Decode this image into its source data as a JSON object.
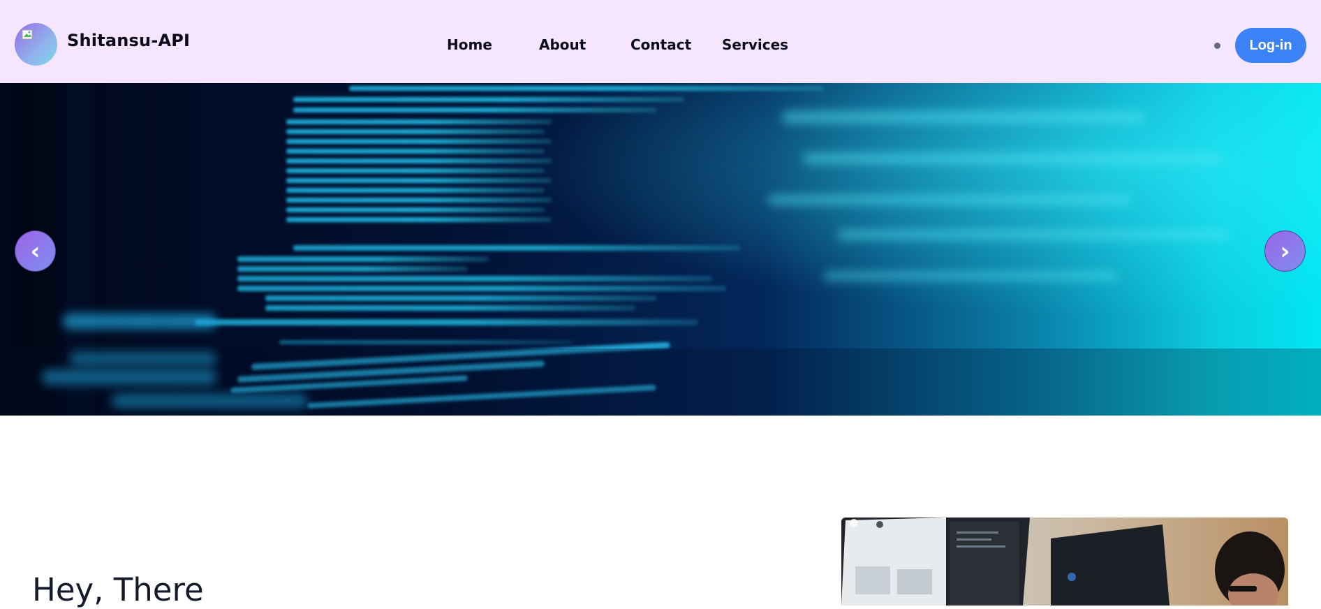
{
  "header": {
    "brand_name": "Shitansu-API",
    "logo_icon": "user-avatar-logo",
    "nav": [
      {
        "label": "Home"
      },
      {
        "label": "About"
      },
      {
        "label": "Contact"
      },
      {
        "label": "Services"
      }
    ],
    "login_label": "Log-in",
    "colors": {
      "header_bg": "#f5e5ff",
      "login_bg": "#3b82f6"
    }
  },
  "carousel": {
    "image": "code-on-screen-banner",
    "prev_label": "‹",
    "next_label": "›"
  },
  "intro": {
    "heading": "Hey, There",
    "image": "developer-at-computer-photo"
  }
}
